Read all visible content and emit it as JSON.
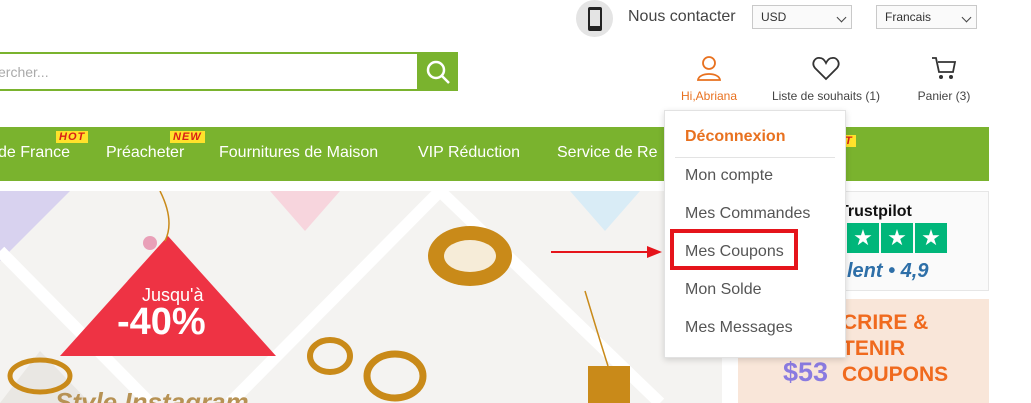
{
  "topbar": {
    "contact_label": "Nous contacter",
    "phone_icon": "phone-icon",
    "currency": "USD",
    "language": "Francais"
  },
  "search": {
    "placeholder": "ercher...",
    "button_icon": "search-icon"
  },
  "user_tools": {
    "account_label": "Hi,Abriana",
    "wishlist_label": "Liste de souhaits (1)",
    "cart_label": "Panier (3)"
  },
  "nav": {
    "items": [
      {
        "label": "de France",
        "badge": "HOT"
      },
      {
        "label": "Préacheter",
        "badge": "NEW"
      },
      {
        "label": "Fournitures de Maison",
        "badge": ""
      },
      {
        "label": "VIP Réduction",
        "badge": ""
      },
      {
        "label": "Service de Re",
        "badge": ""
      }
    ]
  },
  "banner": {
    "discount_top": "Jusqu'à",
    "discount_value": "-40%",
    "bottom_text": "Style Instagram"
  },
  "trustpilot": {
    "brand": "Trustpilot",
    "rating_text": "lent • 4,9",
    "stars": 3
  },
  "promo": {
    "line1": "CRIRE &",
    "line2": "TENIR",
    "amount": "$53",
    "line3": "COUPONS"
  },
  "account_menu": {
    "header": "Déconnexion",
    "items": [
      "Mon compte",
      "Mes Commandes",
      "Mes Coupons",
      "Mon Solde",
      "Mes Messages"
    ],
    "highlighted": "Mes Coupons"
  },
  "colors": {
    "brand_green": "#7ab32e",
    "accent_orange": "#e8711f",
    "highlight_red": "#e5141b"
  }
}
